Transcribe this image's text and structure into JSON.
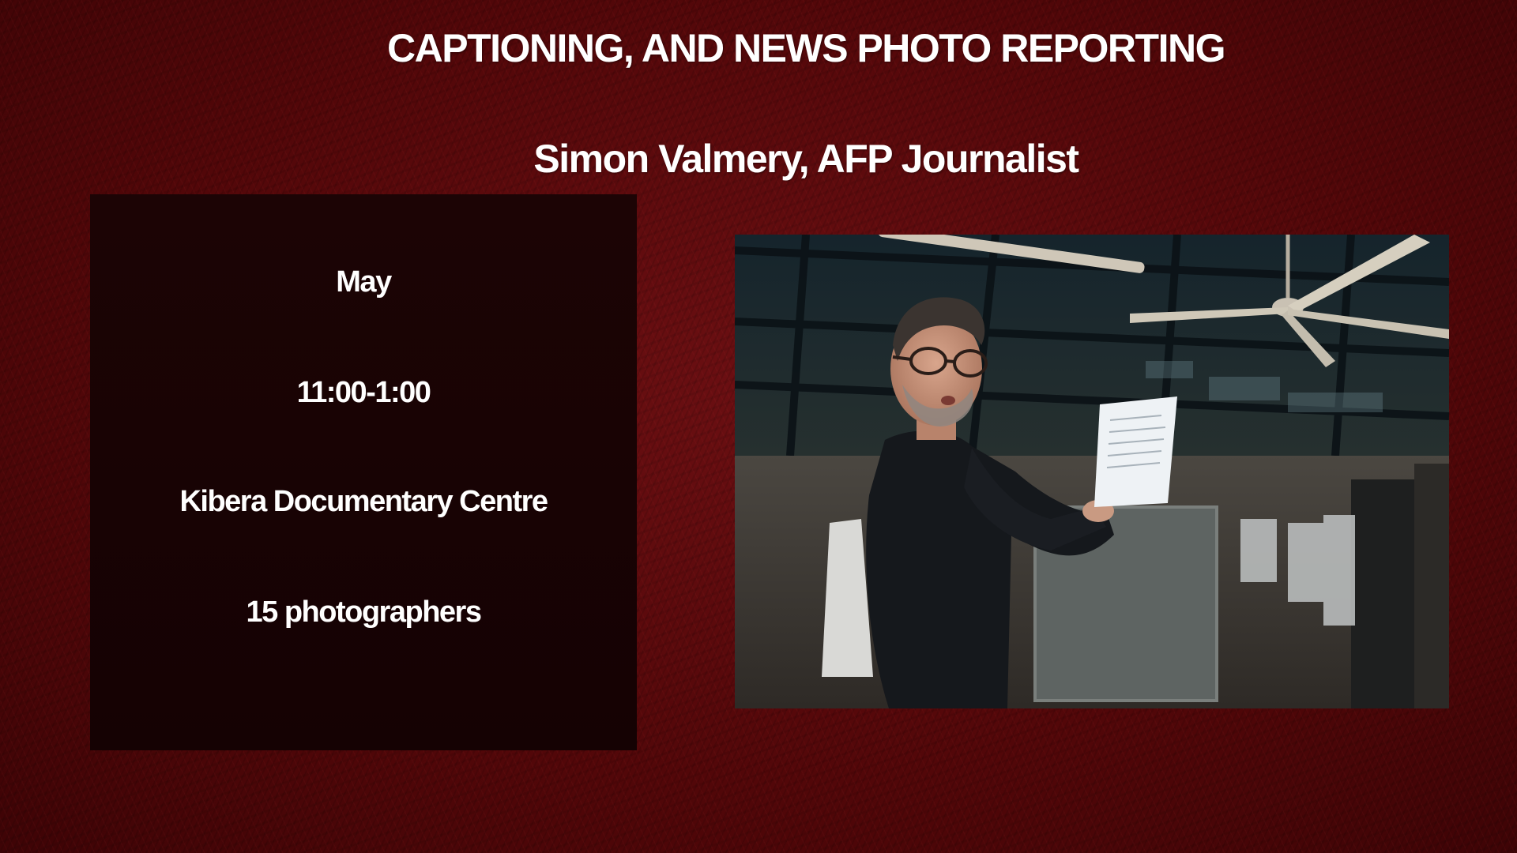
{
  "slide": {
    "title": "CAPTIONING, AND NEWS PHOTO REPORTING",
    "subtitle": "Simon Valmery, AFP Journalist",
    "background_color": "#5a0a0c"
  },
  "info_box": {
    "date": "May",
    "time": "11:00-1:00",
    "venue": "Kibera Documentary Centre",
    "attendees": "15 photographers",
    "background_color": "#180304"
  },
  "photo": {
    "subject": "man in black sweater and glasses holding a sheet of paper",
    "icons": [
      "ceiling-fan",
      "paper-sheet"
    ]
  }
}
